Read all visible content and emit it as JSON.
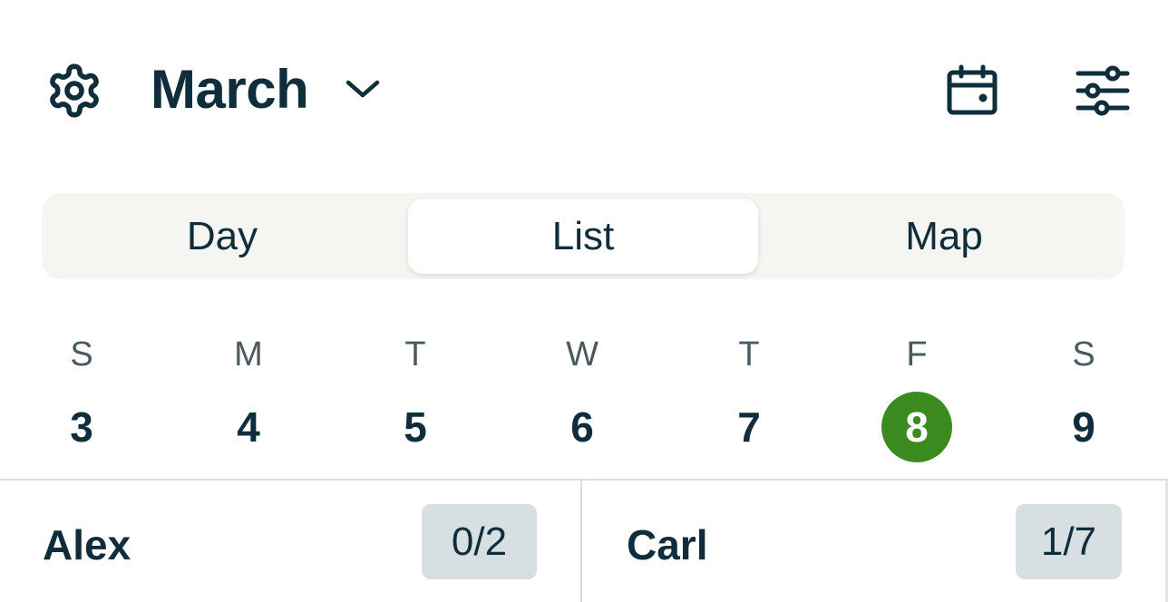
{
  "header": {
    "month": "March",
    "icons": {
      "settings": "gear-icon",
      "month_dropdown": "chevron-down-icon",
      "calendar": "calendar-icon",
      "filters": "sliders-icon"
    }
  },
  "view_tabs": [
    {
      "label": "Day",
      "selected": false
    },
    {
      "label": "List",
      "selected": true
    },
    {
      "label": "Map",
      "selected": false
    }
  ],
  "week": [
    {
      "letter": "S",
      "date": "3",
      "selected": false
    },
    {
      "letter": "M",
      "date": "4",
      "selected": false
    },
    {
      "letter": "T",
      "date": "5",
      "selected": false
    },
    {
      "letter": "W",
      "date": "6",
      "selected": false
    },
    {
      "letter": "T",
      "date": "7",
      "selected": false
    },
    {
      "letter": "F",
      "date": "8",
      "selected": true
    },
    {
      "letter": "S",
      "date": "9",
      "selected": false
    }
  ],
  "people": [
    {
      "name": "Alex",
      "count": "0/2"
    },
    {
      "name": "Carl",
      "count": "1/7"
    }
  ],
  "colors": {
    "primary_text": "#0f2d3a",
    "selected_date": "#3a8a20",
    "segment_bg": "#f5f5f2",
    "badge_bg": "#d7dfe2"
  }
}
